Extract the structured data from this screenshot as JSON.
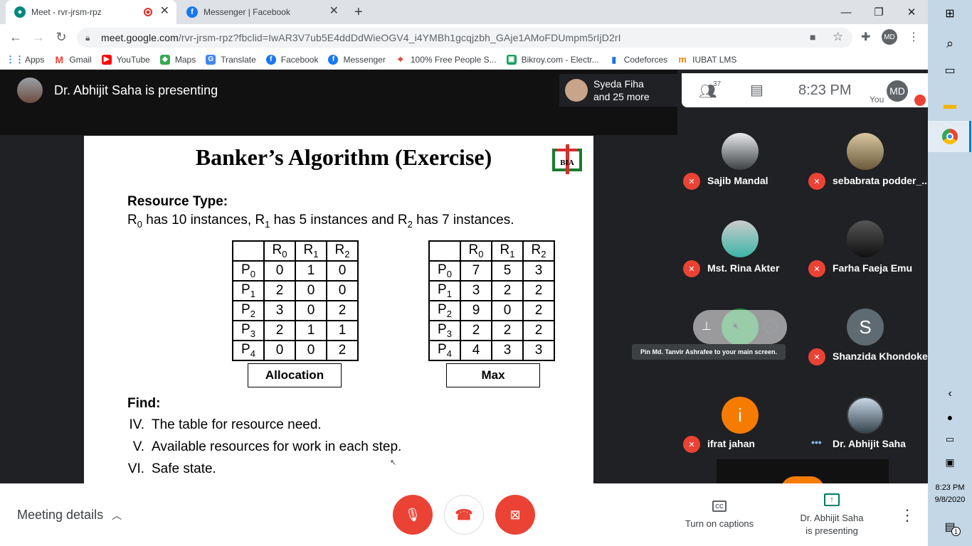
{
  "browser": {
    "tabs": [
      {
        "title": "Meet - rvr-jrsm-rpz",
        "active": true,
        "recording": true
      },
      {
        "title": "Messenger | Facebook",
        "active": false
      }
    ],
    "url_host": "meet.google.com",
    "url_path": "/rvr-jrsm-rpz?fbclid=IwAR3V7ub5E4ddDdWieOGV4_i4YMBh1gcqjzbh_GAje1AMoFDUmpm5rIjD2rI",
    "profile_initials": "MD",
    "bookmarks": [
      "Apps",
      "Gmail",
      "YouTube",
      "Maps",
      "Translate",
      "Facebook",
      "Messenger",
      "100% Free People S...",
      "Bikroy.com - Electr...",
      "Codeforces",
      "IUBAT LMS"
    ]
  },
  "meet": {
    "presenting_text": "Dr. Abhijit Saha is presenting",
    "others_line1": "Syeda Fiha",
    "others_line2": "and 25 more",
    "people_count": "37",
    "time": "8:23 PM",
    "you_label": "You",
    "you_initials": "MD",
    "participants": [
      {
        "name": "Sajib Mandal",
        "muted": true
      },
      {
        "name": "sebabrata podder_...",
        "muted": true
      },
      {
        "name": "Mst. Rina Akter",
        "muted": true
      },
      {
        "name": "Farha Faeja Emu",
        "muted": true
      },
      {
        "name": "Shanzida Khondoker",
        "muted": true,
        "initial": "S"
      },
      {
        "name": "ifrat jahan",
        "muted": true,
        "initial": "i"
      },
      {
        "name": "Dr. Abhijit Saha",
        "muted": false
      }
    ],
    "tooltip": "Pin Md. Tanvir Ashrafee to your main screen.",
    "meeting_details": "Meeting details",
    "captions_label": "Turn on captions",
    "present_label_1": "Dr. Abhijit Saha",
    "present_label_2": "is presenting",
    "colors": {
      "red": "#ea4335",
      "dark": "#202124",
      "orange": "#f57c00",
      "teal": "#00796b"
    }
  },
  "slide": {
    "title": "Banker’s Algorithm (Exercise)",
    "logo_letters": "BIA",
    "resource_type_label": "Resource Type:",
    "res_parts": [
      "R",
      "0",
      " has 10 instances,  R",
      "1",
      " has 5 instances and R",
      "2",
      " has 7 instances."
    ],
    "columns": [
      "R0",
      "R1",
      "R2"
    ],
    "rows": [
      "P0",
      "P1",
      "P2",
      "P3",
      "P4"
    ],
    "allocation": [
      [
        0,
        1,
        0
      ],
      [
        2,
        0,
        0
      ],
      [
        3,
        0,
        2
      ],
      [
        2,
        1,
        1
      ],
      [
        0,
        0,
        2
      ]
    ],
    "max": [
      [
        7,
        5,
        3
      ],
      [
        3,
        2,
        2
      ],
      [
        9,
        0,
        2
      ],
      [
        2,
        2,
        2
      ],
      [
        4,
        3,
        3
      ]
    ],
    "allocation_label": "Allocation",
    "max_label": "Max",
    "find_label": "Find:",
    "questions": [
      {
        "num": "IV.",
        "text": "The table for resource need."
      },
      {
        "num": "V.",
        "text": "Available resources for work in each step."
      },
      {
        "num": "VI.",
        "text": "Safe state."
      }
    ]
  },
  "taskbar": {
    "time": "8:23 PM",
    "date": "9/8/2020",
    "notifications": "1"
  }
}
